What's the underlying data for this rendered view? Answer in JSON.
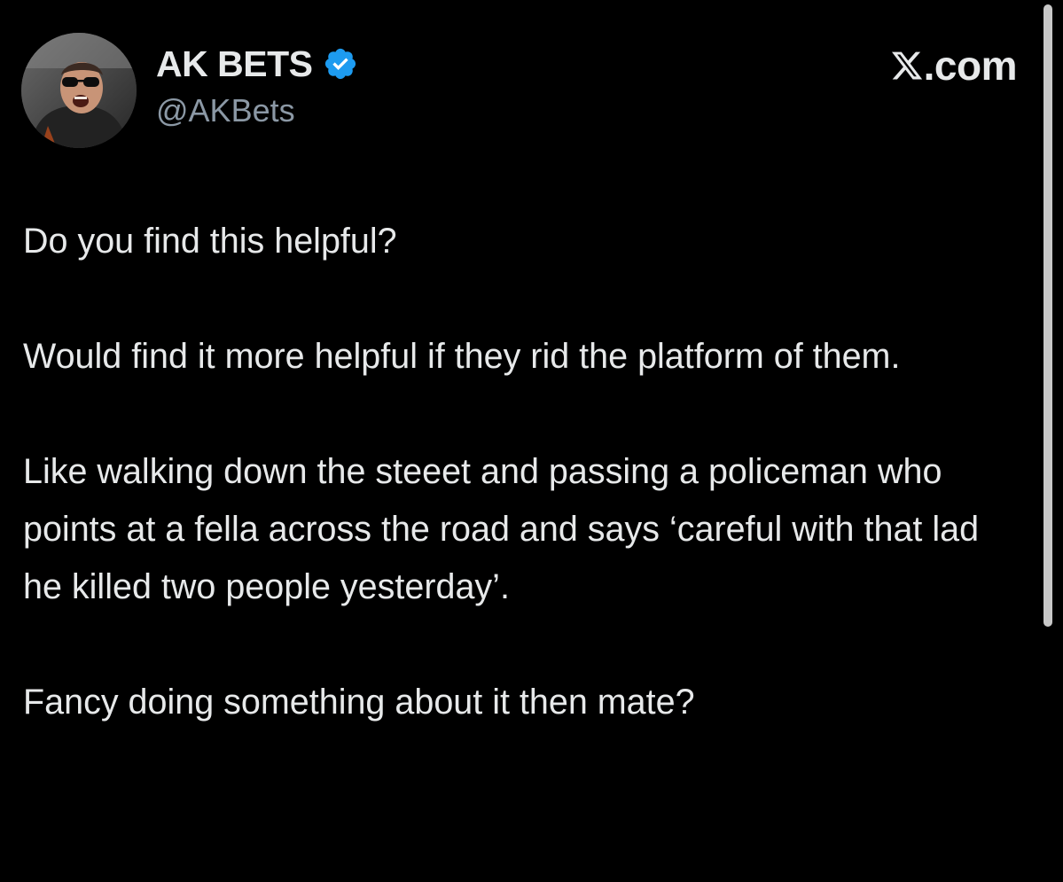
{
  "author": {
    "display_name": "AK BETS",
    "handle": "@AKBets",
    "verified": true,
    "avatar_icon": "profile-photo"
  },
  "brand": {
    "logo_icon": "x-logo-icon",
    "suffix": ".com"
  },
  "tweet": {
    "paragraphs": [
      "Do you find this helpful?",
      "Would find it more helpful if they rid the platform of them.",
      "Like walking down the steeet and passing a policeman who points at a fella across the road and says ‘careful with that lad he killed two people yesterday’.",
      "Fancy doing something about it then mate?"
    ]
  },
  "colors": {
    "background": "#000000",
    "text": "#e7e9ea",
    "secondary_text": "#8b98a5",
    "verified_blue": "#1d9bf0"
  }
}
